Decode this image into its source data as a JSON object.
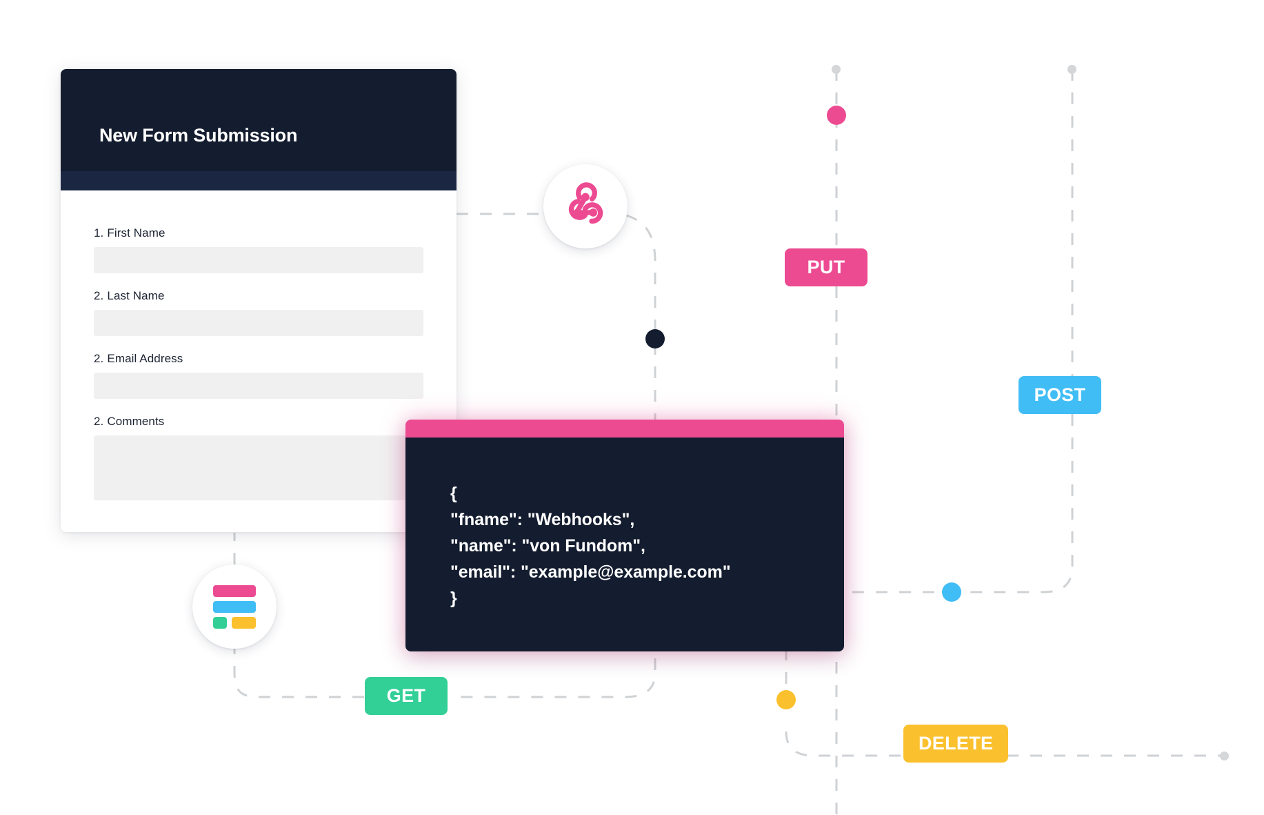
{
  "form_card": {
    "title": "New Form Submission",
    "fields": [
      {
        "number": "1.",
        "label": "First Name",
        "value": "",
        "type": "input"
      },
      {
        "number": "2.",
        "label": "Last Name",
        "value": "",
        "type": "input"
      },
      {
        "number": "2.",
        "label": "Email Address",
        "value": "",
        "type": "input"
      },
      {
        "number": "2.",
        "label": "Comments",
        "value": "",
        "type": "textarea"
      }
    ]
  },
  "code_panel": {
    "lines": [
      "{",
      "\"fname\": \"Webhooks\",",
      "\"name\": \"von Fundom\",",
      "\"email\": \"example@example.com\"",
      "}"
    ]
  },
  "method_badges": [
    {
      "id": "put",
      "label": "PUT",
      "color": "#ec4b92"
    },
    {
      "id": "post",
      "label": "POST",
      "color": "#40bdf5"
    },
    {
      "id": "get",
      "label": "GET",
      "color": "#32cf96"
    },
    {
      "id": "delete",
      "label": "DELETE",
      "color": "#fbc02d"
    }
  ],
  "icons": {
    "webhook": "webhook-icon",
    "form_list": "form-list-icon"
  },
  "form_icon_bars": [
    {
      "name": "pink-bar",
      "color": "#ec4b92"
    },
    {
      "name": "blue-bar",
      "color": "#40bdf5"
    },
    {
      "name": "green-bar",
      "color": "#32cf96"
    },
    {
      "name": "yellow-bar",
      "color": "#fbc02d"
    }
  ],
  "nodes": [
    {
      "name": "node-gray-top",
      "color": "#d4d6d8",
      "size": 13
    },
    {
      "name": "node-gray-top-right",
      "color": "#d4d6d8",
      "size": 13
    },
    {
      "name": "node-pink",
      "color": "#ec4b92",
      "size": 27
    },
    {
      "name": "node-dark",
      "color": "#141c2f",
      "size": 27
    },
    {
      "name": "node-blue",
      "color": "#40bdf5",
      "size": 27
    },
    {
      "name": "node-yellow",
      "color": "#fbc02d",
      "size": 27
    },
    {
      "name": "node-gray-bottom-right",
      "color": "#d4d6d8",
      "size": 13
    }
  ],
  "colors": {
    "dark_navy": "#141c2f",
    "header_stripe": "#1b2742",
    "pink": "#ec4b92",
    "blue": "#40bdf5",
    "green": "#32cf96",
    "yellow": "#fbc02d",
    "dash_gray": "#cfd2d4",
    "field_gray": "#f0f0f0"
  }
}
